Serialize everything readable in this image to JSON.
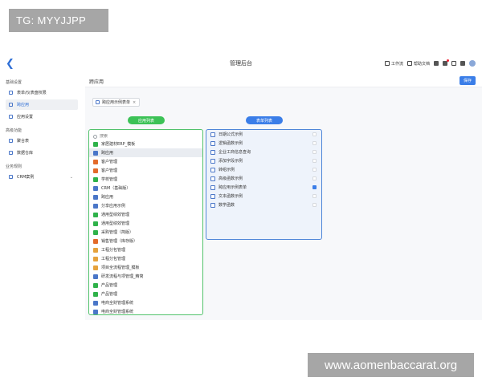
{
  "watermark": {
    "top": "TG: MYYJJPP",
    "bottom": "www.aomenbaccarat.org"
  },
  "header": {
    "title": "管理后台",
    "actions": [
      {
        "label": "工作流",
        "icon": "workflow-icon"
      },
      {
        "label": "帮助文档",
        "icon": "help-doc-icon"
      }
    ]
  },
  "sidebar": {
    "sections": [
      {
        "title": "基础设置",
        "items": [
          {
            "label": "表单/仪表盘权限",
            "icon": "settings-icon",
            "active": false
          },
          {
            "label": "跨应用",
            "icon": "grid-icon",
            "active": true
          },
          {
            "label": "应用设置",
            "icon": "app-settings-icon",
            "active": false
          }
        ]
      },
      {
        "title": "高级功能",
        "items": [
          {
            "label": "聚合表",
            "icon": "table-icon",
            "active": false
          },
          {
            "label": "数据仓库",
            "icon": "warehouse-icon",
            "active": false
          }
        ]
      },
      {
        "title": "业务规则",
        "items": [
          {
            "label": "CRM案例",
            "icon": "gear-icon",
            "active": false,
            "expandable": true
          }
        ]
      }
    ]
  },
  "main": {
    "page_title": "跨应用",
    "save_label": "保存",
    "tab_chip": "跨应用示例表单"
  },
  "left_panel": {
    "label": "应用列表",
    "search_placeholder": "搜索",
    "items": [
      {
        "label": "家居建材ERP_模板",
        "color": "#2fb24a"
      },
      {
        "label": "跨应用",
        "color": "#4a76c8",
        "selected": true
      },
      {
        "label": "客户管理",
        "color": "#e36a2a"
      },
      {
        "label": "客户管理",
        "color": "#e36a2a"
      },
      {
        "label": "学校管理",
        "color": "#2fb24a"
      },
      {
        "label": "CRM（基础版）",
        "color": "#4a76c8"
      },
      {
        "label": "跨应用",
        "color": "#4a76c8"
      },
      {
        "label": "分享应用示例",
        "color": "#4a76c8"
      },
      {
        "label": "通用型绩效管理",
        "color": "#2fb24a"
      },
      {
        "label": "通用型绩效管理",
        "color": "#2fb24a"
      },
      {
        "label": "采购管理（简版）",
        "color": "#2fb24a"
      },
      {
        "label": "销售管理（库存版）",
        "color": "#e36a2a"
      },
      {
        "label": "工程分包管理",
        "color": "#e6a23c"
      },
      {
        "label": "工程分包管理",
        "color": "#e6a23c"
      },
      {
        "label": "项目全流程管理_模板",
        "color": "#e6a23c"
      },
      {
        "label": "研发流程与项管理_精简",
        "color": "#4a76c8"
      },
      {
        "label": "产品管理",
        "color": "#2fb24a"
      },
      {
        "label": "产品管理",
        "color": "#2fb24a"
      },
      {
        "label": "电商全财管理系统",
        "color": "#4a76c8"
      },
      {
        "label": "电商全财管理系统",
        "color": "#4a76c8"
      },
      {
        "label": "图书馆藏管理_模板",
        "color": "#4a76c8"
      }
    ]
  },
  "right_panel": {
    "label": "表单列表",
    "items": [
      {
        "label": "日期公式示例",
        "checked": false
      },
      {
        "label": "逻辑函数示例",
        "checked": false
      },
      {
        "label": "企业工商信息查询",
        "checked": false
      },
      {
        "label": "添加字段示例",
        "checked": false
      },
      {
        "label": "转组示例",
        "checked": false
      },
      {
        "label": "高级函数示例",
        "checked": false
      },
      {
        "label": "跨应用示例表单",
        "checked": true
      },
      {
        "label": "文本函数示例",
        "checked": false
      },
      {
        "label": "数学函数",
        "checked": false
      }
    ]
  }
}
